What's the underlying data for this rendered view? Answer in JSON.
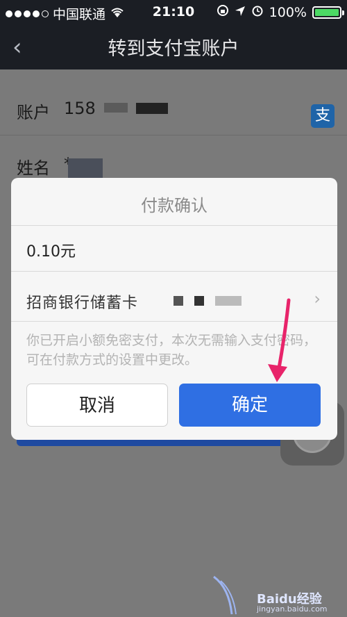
{
  "status_bar": {
    "carrier": "中国联通",
    "time": "21:10",
    "battery": "100%"
  },
  "nav": {
    "title": "转到支付宝账户"
  },
  "form": {
    "account_label": "账户",
    "account_value": "158",
    "name_label": "姓名",
    "name_value": "*"
  },
  "dialog": {
    "title": "付款确认",
    "amount": "0.10元",
    "payment_method": "招商银行储蓄卡",
    "note": "你已开启小额免密支付，本次无需输入支付密码，可在付款方式的设置中更改。",
    "cancel_label": "取消",
    "confirm_label": "确定"
  },
  "watermark": {
    "brand": "Baidu经验",
    "url": "jingyan.baidu.com"
  },
  "colors": {
    "nav_bg": "#1b1e24",
    "confirm_blue": "#2f6fe3",
    "arrow": "#e8246a",
    "battery": "#4cd964"
  }
}
